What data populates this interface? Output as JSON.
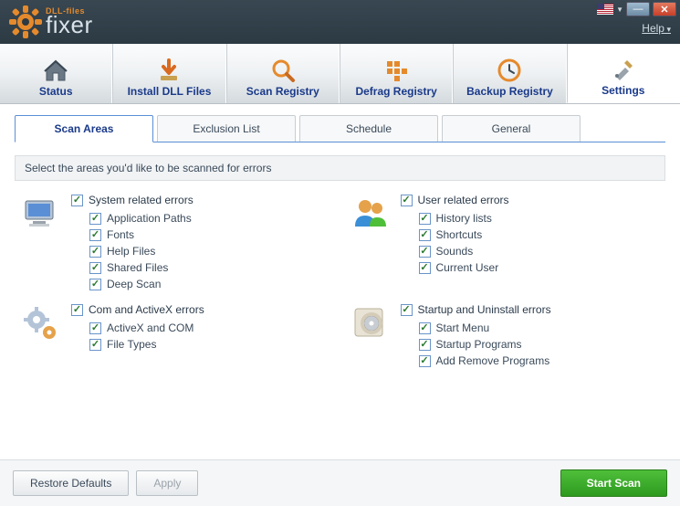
{
  "titlebar": {
    "brand_small": "DLL-files",
    "brand_large": "fixer",
    "help": "Help"
  },
  "maintabs": [
    {
      "label": "Status"
    },
    {
      "label": "Install DLL Files"
    },
    {
      "label": "Scan Registry"
    },
    {
      "label": "Defrag Registry"
    },
    {
      "label": "Backup Registry"
    },
    {
      "label": "Settings"
    }
  ],
  "subtabs": [
    {
      "label": "Scan Areas"
    },
    {
      "label": "Exclusion List"
    },
    {
      "label": "Schedule"
    },
    {
      "label": "General"
    }
  ],
  "instruction": "Select the areas you'd like to be scanned for errors",
  "areas": {
    "system": {
      "title": "System related errors",
      "items": [
        "Application Paths",
        "Fonts",
        "Help Files",
        "Shared Files",
        "Deep Scan"
      ]
    },
    "user": {
      "title": "User related errors",
      "items": [
        "History lists",
        "Shortcuts",
        "Sounds",
        "Current User"
      ]
    },
    "com": {
      "title": "Com and ActiveX errors",
      "items": [
        "ActiveX and COM",
        "File Types"
      ]
    },
    "startup": {
      "title": "Startup and Uninstall errors",
      "items": [
        "Start Menu",
        "Startup Programs",
        "Add Remove Programs"
      ]
    }
  },
  "footer": {
    "restore": "Restore Defaults",
    "apply": "Apply",
    "start_scan": "Start Scan"
  }
}
